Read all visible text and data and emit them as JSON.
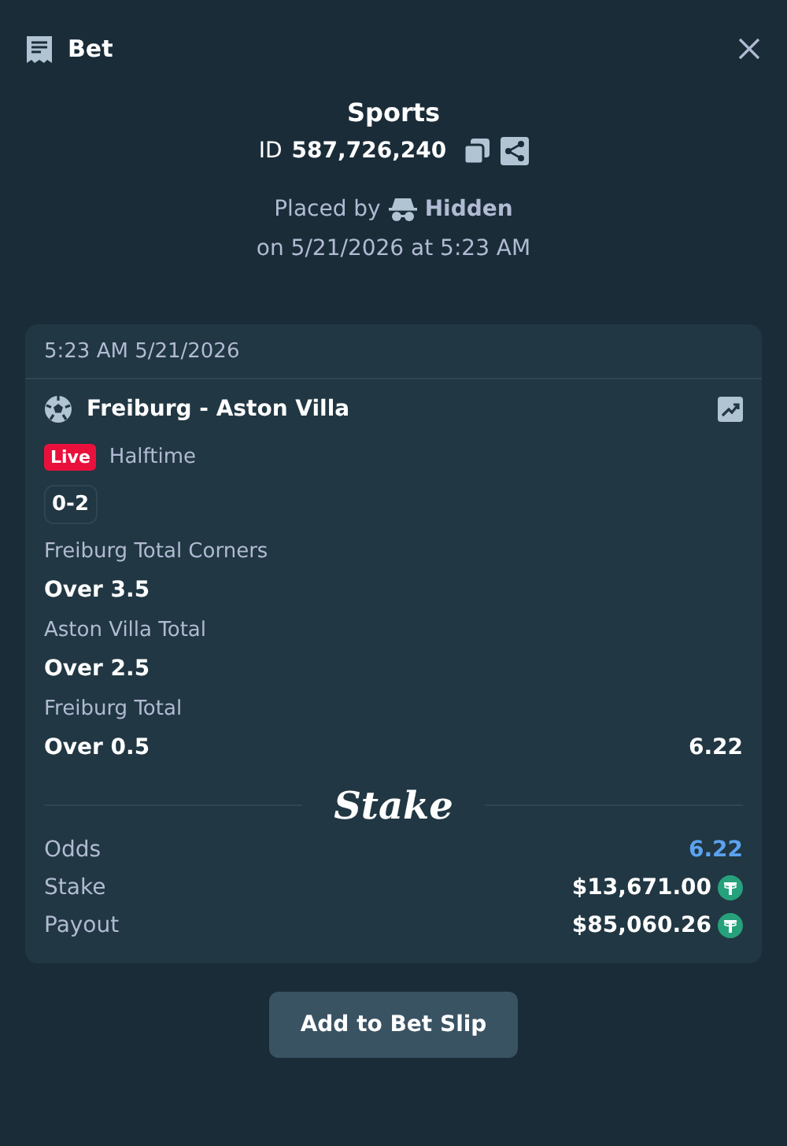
{
  "header": {
    "title": "Bet"
  },
  "bet": {
    "category": "Sports",
    "id_label": "ID",
    "id": "587,726,240",
    "placed_by_label": "Placed by",
    "user": "Hidden",
    "placed_on": "on 5/21/2026 at 5:23 AM"
  },
  "card": {
    "timestamp": "5:23 AM 5/21/2026",
    "match": "Freiburg - Aston Villa",
    "live_badge": "Live",
    "status": "Halftime",
    "score": "0-2",
    "legs": [
      {
        "market": "Freiburg Total Corners",
        "selection": "Over 3.5"
      },
      {
        "market": "Aston Villa Total",
        "selection": "Over 2.5"
      },
      {
        "market": "Freiburg Total",
        "selection": "Over 0.5",
        "odds": "6.22"
      }
    ],
    "brand": "Stake",
    "summary": [
      {
        "kind": "odds",
        "label": "Odds",
        "value": "6.22"
      },
      {
        "kind": "amount",
        "label": "Stake",
        "value": "$13,671.00"
      },
      {
        "kind": "amount",
        "label": "Payout",
        "value": "$85,060.26"
      }
    ]
  },
  "button": "Add to Bet Slip"
}
